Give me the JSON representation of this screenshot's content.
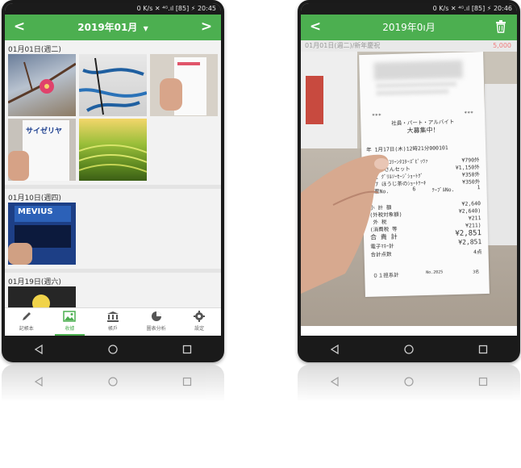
{
  "left_phone": {
    "status_text": "0 K/s ✕ ⁴ᴳ.ıl [85] ⚡ 20:45",
    "title": "2019年01月",
    "dropdown_glyph": "▼",
    "prev_glyph": "<",
    "next_glyph": ">",
    "sections": [
      {
        "date": "01月01日(週二)"
      },
      {
        "date": "01月10日(週四)"
      },
      {
        "date": "01月19日(週六)"
      }
    ],
    "thumb_texts": {
      "receipt_brand": "サイゼリヤ",
      "pack_brand": "MEVIUS"
    },
    "tabs": [
      {
        "label": "記帳本",
        "icon": "pencil-icon"
      },
      {
        "label": "收據",
        "icon": "image-icon"
      },
      {
        "label": "帳戶",
        "icon": "bank-icon"
      },
      {
        "label": "圖表分析",
        "icon": "pie-chart-icon"
      },
      {
        "label": "設定",
        "icon": "gear-icon"
      }
    ],
    "active_tab": "收據",
    "accent": "#4caf50"
  },
  "right_phone": {
    "status_text": "0 K/s ✕ ⁴ᴳ.ıl [85] ⚡ 20:46",
    "title": "2019年0ı月",
    "back_glyph": "<",
    "entry_label": "01月01日(週二)/新年慶祝",
    "entry_amount": "5,000",
    "receipt": {
      "line1": "***",
      "line2": "社員・パート・アルバイト",
      "line3": "大募集中！",
      "line4": "年 1月17日(木)12時21分000101",
      "items": [
        {
          "name": "096 ｱｸﾘｺﾘｰﾝﾀｺﾀｰｽﾞﾋﾟｯﾂｧ",
          "price": "¥790外"
        },
        {
          "name": "ポポラさんセット",
          "price": "¥1,150外"
        },
        {
          "name": "231 ｸﾞﾘﾙｿｰｾｰｼﾞｼｮｰﾄｸﾞ",
          "price": "¥350外"
        },
        {
          "name": "237 ほうじ茶のｼｮｰﾄｹｰｷ",
          "price": "¥350外"
        }
      ],
      "slip_label": "伝票No.",
      "slip_no": "6",
      "table_label": "ﾃｰﾌﾞﾙNo.",
      "table_no": "1",
      "subtotal_label": "小 計 額",
      "subtotal": "¥2,640",
      "taxable_label": "(外税対象額)",
      "taxable": "¥2,640)",
      "tax_label": "外 税",
      "tax": "¥211",
      "inner_tax_label": "(消費税 等",
      "inner_tax": "¥211)",
      "total_label": "合 貴 計",
      "total": "¥2,851",
      "emoney_label": "電子ﾏﾈｰ計",
      "emoney": "¥2,851",
      "count_label": "合計点数",
      "count": "4点",
      "footer_left": "０１担系計",
      "footer_mid": "No.2025",
      "footer_right": "3名"
    }
  },
  "system_nav": {
    "back": "◁",
    "home": "○",
    "recents": "□"
  }
}
